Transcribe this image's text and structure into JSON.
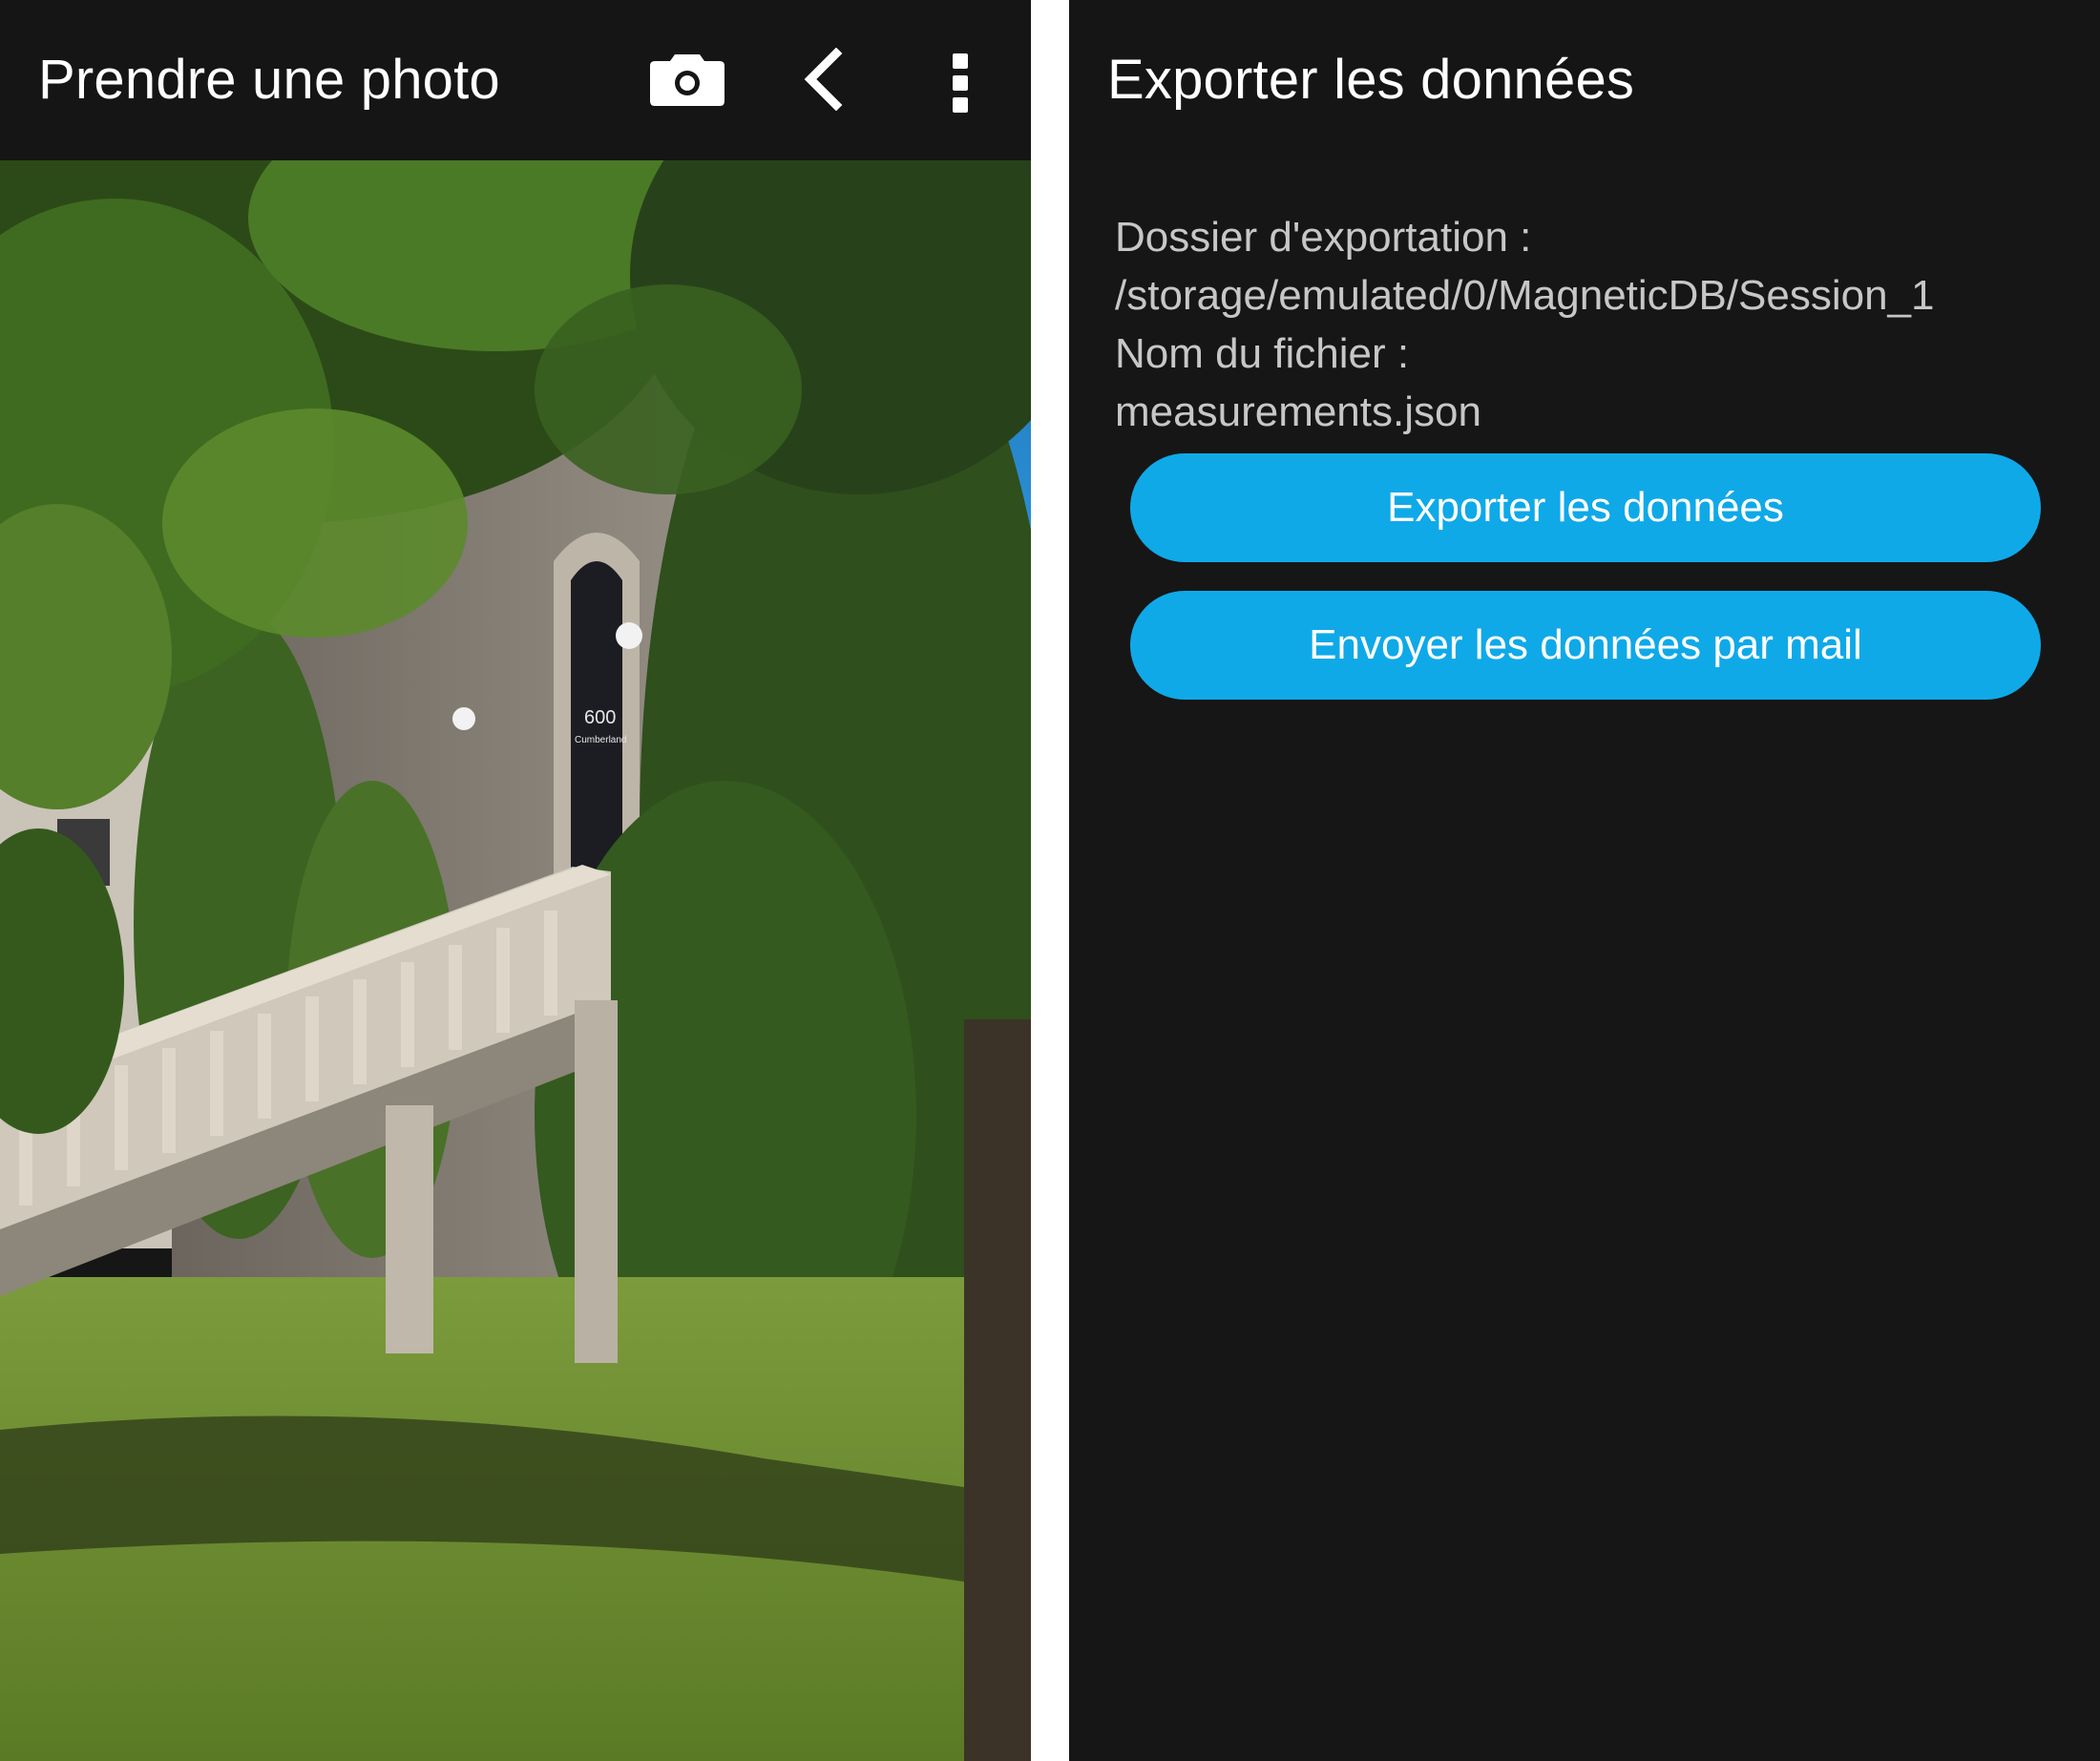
{
  "left_screen": {
    "appbar": {
      "title": "Prendre une photo",
      "actions": [
        {
          "icon": "camera-icon"
        },
        {
          "icon": "back-chevron-icon"
        },
        {
          "icon": "more-vert-icon"
        }
      ]
    },
    "photo": {
      "subject": "building-with-ivy-and-staircase",
      "door_sign_line1": "600",
      "door_sign_line2": "Cumberland"
    }
  },
  "right_screen": {
    "appbar": {
      "title": "Exporter les données"
    },
    "info": {
      "folder_label": "Dossier d'exportation :",
      "folder_path": "/storage/emulated/0/MagneticDB/Session_1",
      "file_label": "Nom du fichier :",
      "file_name": "measurements.json"
    },
    "buttons": {
      "export_label": "Exporter les données",
      "mail_label": "Envoyer les données par mail"
    }
  },
  "colors": {
    "background": "#161616",
    "button": "#0fa9e8",
    "text_primary": "#ffffff",
    "text_secondary": "#c7c7c7"
  }
}
